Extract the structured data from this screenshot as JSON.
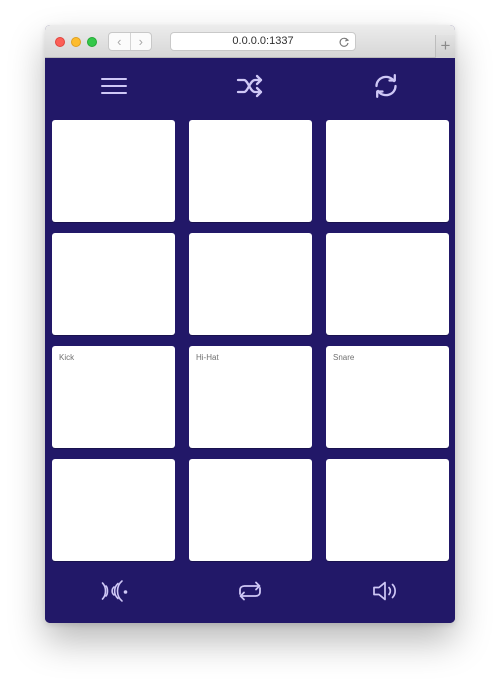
{
  "window": {
    "url": "0.0.0.0:1337",
    "new_tab_symbol": "+",
    "back_symbol": "‹",
    "forward_symbol": "›",
    "icons": [
      "close-button",
      "minimize-button",
      "maximize-button",
      "back-icon",
      "forward-icon",
      "reload-icon",
      "new-tab-icon"
    ]
  },
  "app": {
    "background_color": "#221868",
    "pad_color": "#ffffff",
    "icon_color": "#cfc8f6",
    "top_toolbar_icons": [
      "hamburger-menu-icon",
      "shuffle-icon",
      "sync-icon"
    ],
    "bottom_toolbar_icons": [
      "broadcast-icon",
      "repeat-icon",
      "volume-icon"
    ],
    "pads": [
      {
        "label": ""
      },
      {
        "label": ""
      },
      {
        "label": ""
      },
      {
        "label": ""
      },
      {
        "label": ""
      },
      {
        "label": ""
      },
      {
        "label": "Kick"
      },
      {
        "label": "Hi-Hat"
      },
      {
        "label": "Snare"
      },
      {
        "label": ""
      },
      {
        "label": ""
      },
      {
        "label": ""
      }
    ]
  }
}
